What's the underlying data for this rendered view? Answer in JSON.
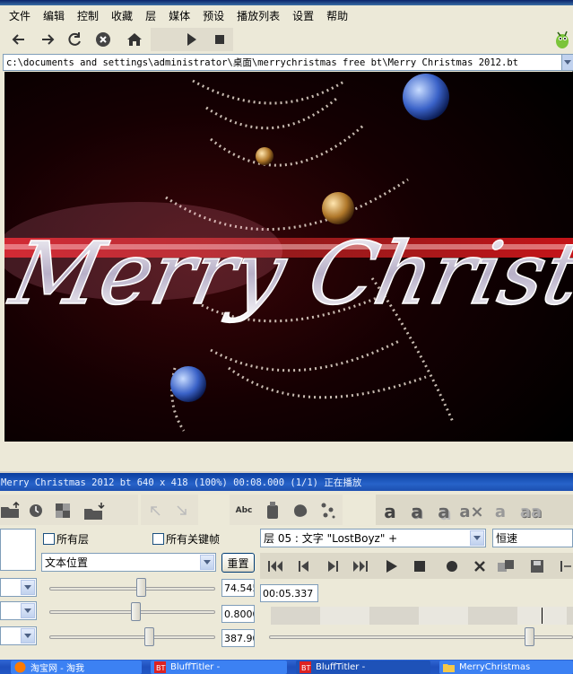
{
  "menubar": {
    "items": [
      "文件",
      "编辑",
      "控制",
      "收藏",
      "层",
      "媒体",
      "预设",
      "播放列表",
      "设置",
      "帮助"
    ]
  },
  "toolbar": {
    "icons": [
      "arrow-left-icon",
      "arrow-right-icon",
      "refresh-icon",
      "stop-circle-icon",
      "home-icon",
      "play-icon",
      "stop-icon",
      "mascot-icon"
    ]
  },
  "address": {
    "path": "c:\\documents and settings\\administrator\\桌面\\merrychristmas free bt\\Merry Christmas 2012.bt"
  },
  "viewport": {
    "caption": "Merry Christmas"
  },
  "bluff": {
    "status": "Merry Christmas 2012 bt 640 x 418 (100%) 00:08.000 (1/1) 正在播放",
    "all_layers_label": "所有层",
    "all_keyframes_label": "所有关键帧",
    "property_combo": "文本位置",
    "reset_button": "重置",
    "layer_combo": "层 05  : 文字 \"LostBoyz\" +",
    "speed_combo": "恒速",
    "time_value": "00:05.337",
    "values": [
      "74.545",
      "0.8000",
      "387.90"
    ],
    "slider_levels": [
      0.55,
      0.52,
      0.6
    ]
  },
  "taskbar": {
    "items": [
      "淘宝网 - 淘我",
      "BluffTitler -",
      "BluffTitler -",
      "MerryChristmas"
    ]
  },
  "colors": {
    "title_blue": "#2763c9",
    "taskbar_blue": "#1f4fbc",
    "accent_red": "#e0202a"
  }
}
